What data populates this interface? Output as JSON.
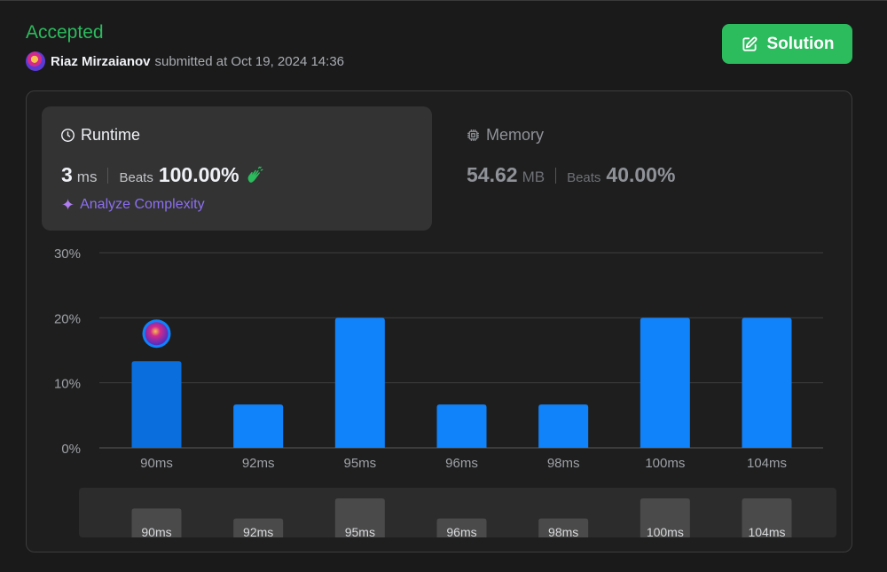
{
  "submission": {
    "status": "Accepted",
    "user": "Riaz Mirzaianov",
    "meta": "submitted at Oct 19, 2024 14:36",
    "solution_label": "Solution"
  },
  "runtime": {
    "title": "Runtime",
    "value": "3",
    "unit": "ms",
    "beats_label": "Beats",
    "beats_value": "100.00%"
  },
  "memory": {
    "title": "Memory",
    "value": "54.62",
    "unit": "MB",
    "beats_label": "Beats",
    "beats_value": "40.00%"
  },
  "analyze_label": "Analyze Complexity",
  "colors": {
    "accent_green": "#2cbb5d",
    "bar_blue": "#1082fa",
    "bar_selected": "#0a6fdd",
    "mini_bar": "#4a4a4a"
  },
  "chart_data": {
    "type": "bar",
    "title": "",
    "xlabel": "",
    "ylabel": "",
    "ylim": [
      0,
      30
    ],
    "yticks": [
      "0%",
      "10%",
      "20%",
      "30%"
    ],
    "categories": [
      "90ms",
      "92ms",
      "95ms",
      "96ms",
      "98ms",
      "100ms",
      "104ms"
    ],
    "values": [
      13.33,
      6.67,
      20,
      6.67,
      6.67,
      20,
      20
    ],
    "selected_index": 0,
    "grid": true
  }
}
